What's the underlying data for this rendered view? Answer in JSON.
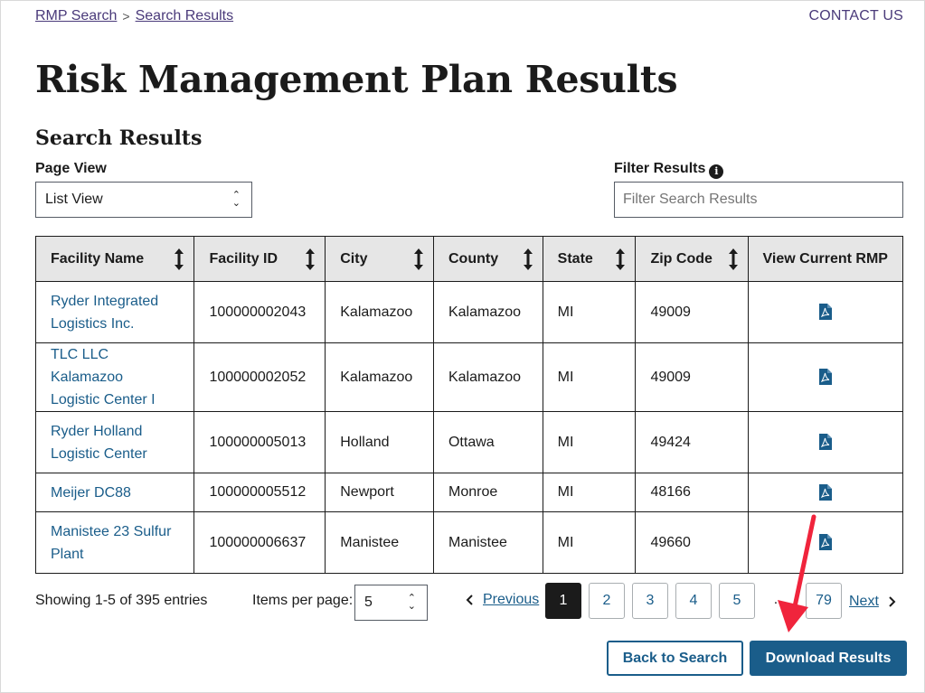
{
  "breadcrumb": {
    "items": [
      "RMP Search",
      "Search Results"
    ],
    "separator": ">"
  },
  "header": {
    "contact_label": "CONTACT US"
  },
  "page": {
    "title": "Risk Management Plan Results",
    "section_title": "Search Results"
  },
  "controls": {
    "page_view_label": "Page View",
    "page_view_value": "List View",
    "filter_label": "Filter Results",
    "filter_placeholder": "Filter Search Results",
    "filter_info_icon": "info-icon"
  },
  "table": {
    "columns": [
      "Facility Name",
      "Facility ID",
      "City",
      "County",
      "State",
      "Zip Code",
      "View Current RMP"
    ],
    "rows": [
      {
        "name_line1": "Ryder Integrated",
        "name_line2": "Logistics Inc.",
        "id": "100000002043",
        "city": "Kalamazoo",
        "county": "Kalamazoo",
        "state": "MI",
        "zip": "49009"
      },
      {
        "name_line1": "TLC LLC Kalamazoo",
        "name_line2": "Logistic Center I",
        "id": "100000002052",
        "city": "Kalamazoo",
        "county": "Kalamazoo",
        "state": "MI",
        "zip": "49009"
      },
      {
        "name_line1": "Ryder Holland",
        "name_line2": "Logistic Center",
        "id": "100000005013",
        "city": "Holland",
        "county": "Ottawa",
        "state": "MI",
        "zip": "49424"
      },
      {
        "name_line1": "Meijer DC88",
        "name_line2": "",
        "id": "100000005512",
        "city": "Newport",
        "county": "Monroe",
        "state": "MI",
        "zip": "48166"
      },
      {
        "name_line1": "Manistee 23 Sulfur",
        "name_line2": "Plant",
        "id": "100000006637",
        "city": "Manistee",
        "county": "Manistee",
        "state": "MI",
        "zip": "49660"
      }
    ]
  },
  "footer": {
    "showing_text": "Showing 1-5 of 395 entries",
    "items_per_page_label": "Items per page:",
    "items_per_page_value": "5"
  },
  "pagination": {
    "previous_label": "Previous",
    "next_label": "Next",
    "pages": [
      "1",
      "2",
      "3",
      "4",
      "5"
    ],
    "current": "1",
    "ellipsis": "…",
    "last_page": "79"
  },
  "actions": {
    "back_label": "Back to Search",
    "download_label": "Download Results"
  },
  "colors": {
    "link": "#1a5d8a",
    "breadcrumb": "#4a3a7a",
    "header_bg": "#e6e6e6",
    "annotation_arrow": "#f0243c"
  }
}
